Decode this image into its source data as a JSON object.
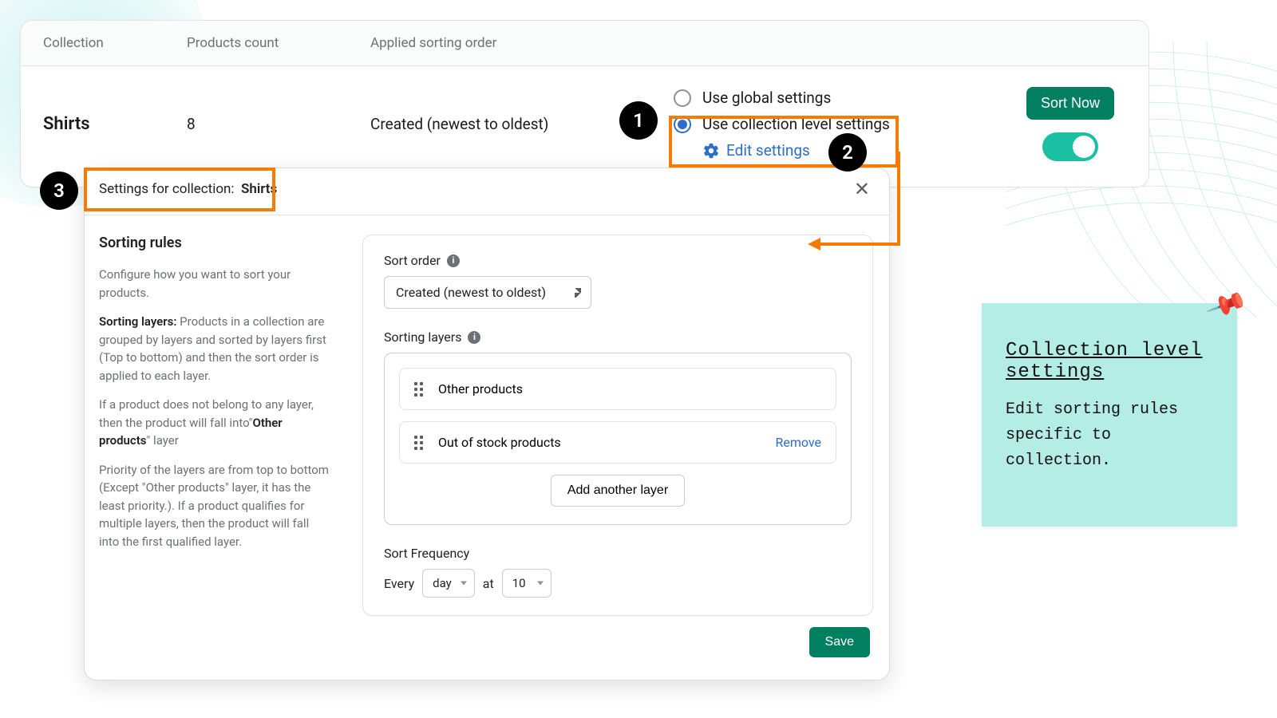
{
  "table": {
    "headers": {
      "collection": "Collection",
      "count": "Products count",
      "sort": "Applied sorting order"
    },
    "row": {
      "name": "Shirts",
      "count": "8",
      "sort_value": "Created (newest to oldest)",
      "radio_global": "Use global settings",
      "radio_collection": "Use collection level settings",
      "edit_settings": "Edit settings",
      "sort_now": "Sort Now"
    }
  },
  "steps": {
    "one": "1",
    "two": "2",
    "three": "3"
  },
  "modal": {
    "title_prefix": "Settings for collection:",
    "title_name": "Shirts",
    "sorting_rules_h": "Sorting rules",
    "p1": "Configure how you want to sort your products.",
    "p2_b": "Sorting layers:",
    "p2": " Products in a collection are grouped by layers and sorted by layers first (Top to bottom) and then the sort order is applied to each layer.",
    "p3a": "If a product does not belong to any layer, then the product will fall into\"",
    "p3b": "Other products",
    "p3c": "\" layer",
    "p4": "Priority of the layers are from top to bottom (Except \"Other products\" layer, it has the least priority.). If a product qualifies for multiple layers, then the product will fall into the first qualified layer.",
    "sort_order_label": "Sort order",
    "sort_order_value": "Created (newest to oldest)",
    "sorting_layers_label": "Sorting layers",
    "layers": {
      "other": "Other products",
      "oos": "Out of stock products",
      "remove": "Remove",
      "add": "Add another layer"
    },
    "freq_label": "Sort Frequency",
    "freq_every": "Every",
    "freq_unit": "day",
    "freq_at": "at",
    "freq_hour": "10",
    "save": "Save"
  },
  "note": {
    "title": "Collection level settings",
    "body": "Edit sorting rules specific to collection."
  }
}
